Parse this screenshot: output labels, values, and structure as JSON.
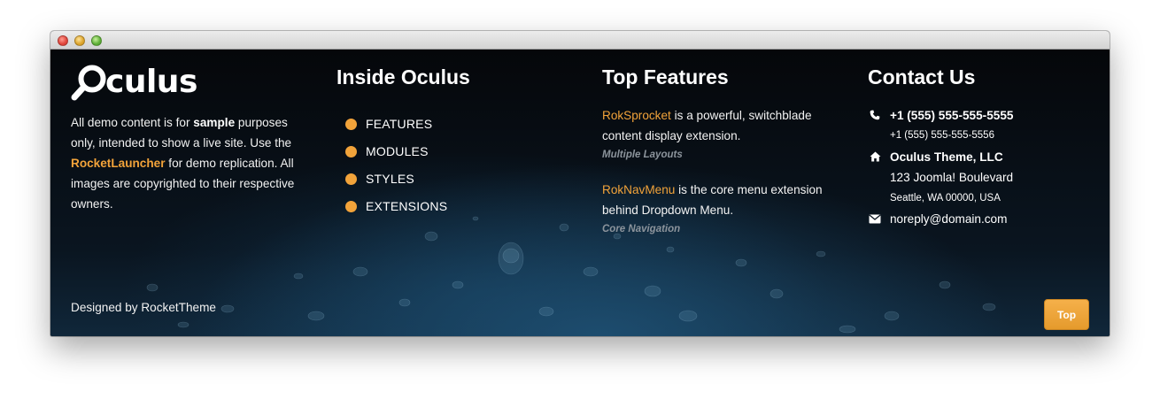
{
  "window": {
    "controls": [
      "close",
      "minimize",
      "zoom"
    ]
  },
  "colors": {
    "accent": "#f2a33a",
    "muted": "#8c949c",
    "background": "#06090d"
  },
  "col1": {
    "logo_text": "culus",
    "about_p1": "All demo content is for ",
    "about_bold": "sample",
    "about_p2": " purposes only, intended to show a live site. Use the ",
    "about_link": "RocketLauncher",
    "about_p3": " for demo replication. All images are copyrighted to their respective owners.",
    "designed_by": "Designed by RocketTheme"
  },
  "col2": {
    "title": "Inside Oculus",
    "menu": [
      {
        "label": "FEATURES"
      },
      {
        "label": "MODULES"
      },
      {
        "label": "STYLES"
      },
      {
        "label": "EXTENSIONS"
      }
    ]
  },
  "col3": {
    "title": "Top Features",
    "features": [
      {
        "link": "RokSprocket",
        "text": " is a powerful, switchblade content display extension.",
        "sub": "Multiple Layouts"
      },
      {
        "link": "RokNavMenu",
        "text": " is the core menu extension behind Dropdown Menu.",
        "sub": "Core Navigation"
      }
    ]
  },
  "col4": {
    "title": "Contact Us",
    "phone_main": "+1 (555) 555-555-5555",
    "phone_alt": "+1 (555) 555-555-5556",
    "company": "Oculus Theme, LLC",
    "street": "123 Joomla! Boulevard",
    "city": "Seattle, WA 00000, USA",
    "email": "noreply@domain.com"
  },
  "top_button": "Top",
  "icons": [
    "magnifier-logo-icon",
    "bullet-icon",
    "phone-icon",
    "home-icon",
    "envelope-icon"
  ]
}
